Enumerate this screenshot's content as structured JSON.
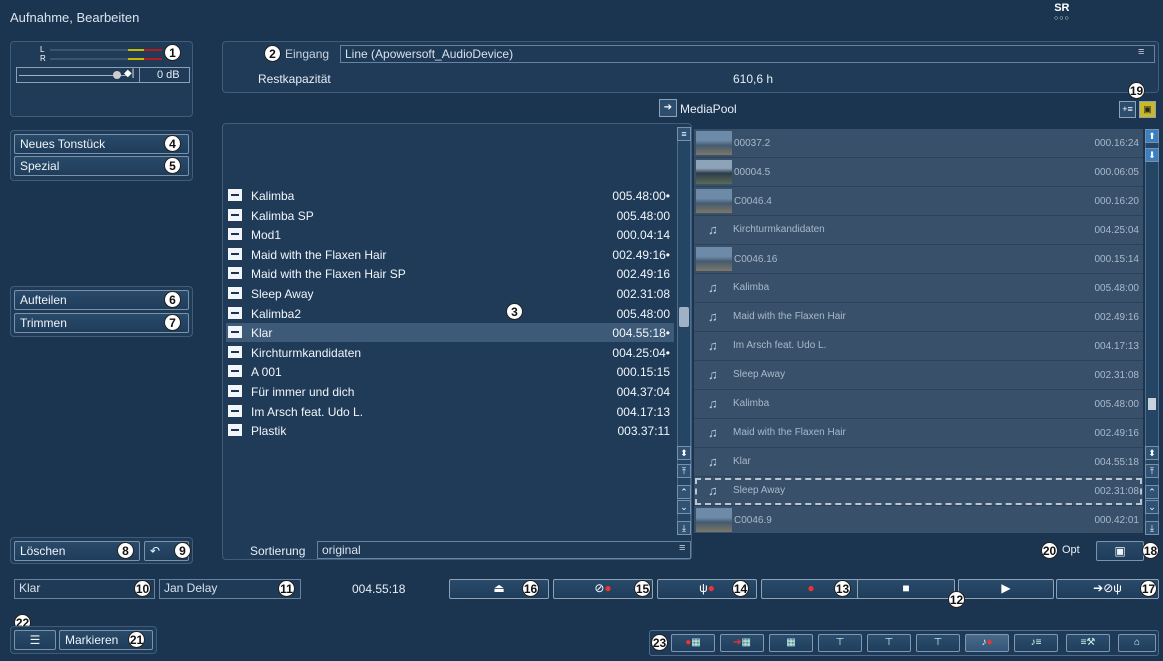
{
  "window": {
    "title": "Aufnahme, Bearbeiten",
    "logo": "SR"
  },
  "meter": {
    "left_label": "L",
    "right_label": "R",
    "gain": "0 dB"
  },
  "input": {
    "label": "Eingang",
    "value": "Line (Apowersoft_AudioDevice)"
  },
  "capacity": {
    "label": "Restkapazität",
    "value": "610,6 h"
  },
  "mediapool": {
    "label": "MediaPool"
  },
  "left_buttons": {
    "neues": "Neues Tonstück",
    "spezial": "Spezial",
    "aufteilen": "Aufteilen",
    "trimmen": "Trimmen",
    "loeschen": "Löschen"
  },
  "tracks": [
    {
      "name": "Kalimba",
      "dur": "005.48:00•"
    },
    {
      "name": "Kalimba SP",
      "dur": "005.48:00"
    },
    {
      "name": "Mod1",
      "dur": "000.04:14"
    },
    {
      "name": "Maid with the Flaxen Hair",
      "dur": "002.49:16•"
    },
    {
      "name": "Maid with the Flaxen Hair SP",
      "dur": "002.49:16"
    },
    {
      "name": "Sleep Away",
      "dur": "002.31:08"
    },
    {
      "name": "Kalimba2",
      "dur": "005.48:00"
    },
    {
      "name": "Klar",
      "dur": "004.55:18•"
    },
    {
      "name": "Kirchturmkandidaten",
      "dur": "004.25:04•"
    },
    {
      "name": "A 001",
      "dur": "000.15:15"
    },
    {
      "name": "Für immer und dich",
      "dur": "004.37:04"
    },
    {
      "name": "Im Arsch feat. Udo L.",
      "dur": "004.17:13"
    },
    {
      "name": "Plastik",
      "dur": "003.37:11"
    }
  ],
  "pool": [
    {
      "type": "video",
      "name": "00037.2",
      "dur": "000.16:24"
    },
    {
      "type": "video",
      "name": "00004.5",
      "dur": "000.06:05"
    },
    {
      "type": "video",
      "name": "C0046.4",
      "dur": "000.16:20"
    },
    {
      "type": "audio",
      "name": "Kirchturmkandidaten",
      "dur": "004.25:04"
    },
    {
      "type": "video",
      "name": "C0046.16",
      "dur": "000.15:14"
    },
    {
      "type": "audio",
      "name": "Kalimba",
      "dur": "005.48:00"
    },
    {
      "type": "audio",
      "name": "Maid with the Flaxen Hair",
      "dur": "002.49:16"
    },
    {
      "type": "audio",
      "name": "Im Arsch feat. Udo L.",
      "dur": "004.17:13"
    },
    {
      "type": "audio",
      "name": "Sleep Away",
      "dur": "002.31:08"
    },
    {
      "type": "audio",
      "name": "Kalimba",
      "dur": "005.48:00"
    },
    {
      "type": "audio",
      "name": "Maid with the Flaxen Hair",
      "dur": "002.49:16"
    },
    {
      "type": "audio",
      "name": "Klar",
      "dur": "004.55:18"
    },
    {
      "type": "audio",
      "name": "Sleep Away",
      "dur": "002.31:08"
    },
    {
      "type": "video",
      "name": "C0046.9",
      "dur": "000.42:01"
    }
  ],
  "sort": {
    "label": "Sortierung",
    "value": "original"
  },
  "opt": "Opt",
  "status": {
    "track": "Klar",
    "artist": "Jan Delay",
    "time": "004.55:18"
  },
  "markieren": "Markieren",
  "badges": [
    "1",
    "2",
    "3",
    "4",
    "5",
    "6",
    "7",
    "8",
    "9",
    "10",
    "11",
    "12",
    "13",
    "14",
    "15",
    "16",
    "17",
    "18",
    "19",
    "20",
    "21",
    "22",
    "23"
  ]
}
